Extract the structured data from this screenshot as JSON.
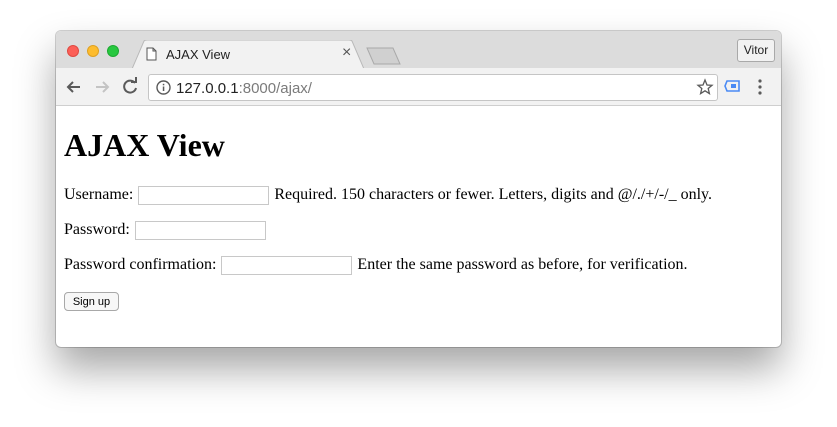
{
  "tab": {
    "title": "AJAX View"
  },
  "profile": {
    "name": "Vitor"
  },
  "omnibox": {
    "url_host": "127.0.0.1",
    "url_rest": ":8000/ajax/"
  },
  "page": {
    "heading": "AJAX View",
    "username": {
      "label": "Username:",
      "value": "",
      "help": "Required. 150 characters or fewer. Letters, digits and @/./+/-/_ only."
    },
    "password": {
      "label": "Password:",
      "value": ""
    },
    "password_confirmation": {
      "label": "Password confirmation:",
      "value": "",
      "help": "Enter the same password as before, for verification."
    },
    "signup_button": "Sign up"
  },
  "icons": {
    "tab_favicon": "page-icon",
    "tab_close": "close-icon",
    "back": "arrow-left-icon",
    "forward": "arrow-right-icon",
    "reload": "reload-icon",
    "info": "info-icon",
    "bookmark": "star-icon",
    "extension": "extension-icon",
    "menu": "kebab-menu-icon"
  },
  "colors": {
    "close": "#fc5f57",
    "minimize": "#fdbc2e",
    "zoom": "#28c840",
    "extension": "#4a8af4"
  }
}
